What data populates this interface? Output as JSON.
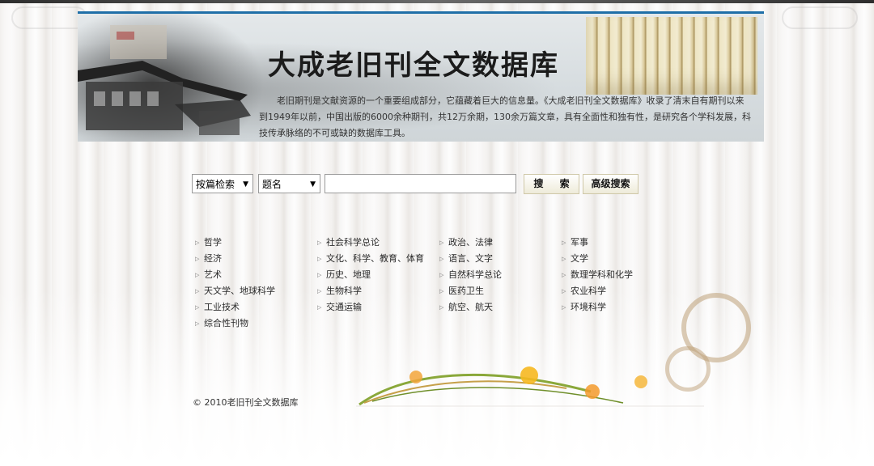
{
  "banner": {
    "title": "大成老旧刊全文数据库",
    "description": "老旧期刊是文献资源的一个重要组成部分，它蕴藏着巨大的信息量。《大成老旧刊全文数据库》收录了清末自有期刊以来到1949年以前，中国出版的6000余种期刊，共12万余期，130余万篇文章，具有全面性和独有性，是研究各个学科发展，科技传承脉络的不可或缺的数据库工具。"
  },
  "search": {
    "mode_selected": "按篇检索",
    "field_selected": "题名",
    "query_value": "",
    "search_label": "搜 索",
    "advanced_label": "高级搜索"
  },
  "categories": {
    "col1": [
      "哲学",
      "经济",
      "艺术",
      "天文学、地球科学",
      "工业技术",
      "综合性刊物"
    ],
    "col2": [
      "社会科学总论",
      "文化、科学、教育、体育",
      "历史、地理",
      "生物科学",
      "交通运输"
    ],
    "col3": [
      "政治、法律",
      "语言、文字",
      "自然科学总论",
      "医药卫生",
      "航空、航天"
    ],
    "col4": [
      "军事",
      "文学",
      "数理学科和化学",
      "农业科学",
      "环境科学"
    ]
  },
  "footer": {
    "copyright": "© 2010老旧刊全文数据库"
  },
  "colors": {
    "banner_border": "#1f6fa8",
    "button_bg": "#eeebd9",
    "text": "#2a2a2a"
  }
}
